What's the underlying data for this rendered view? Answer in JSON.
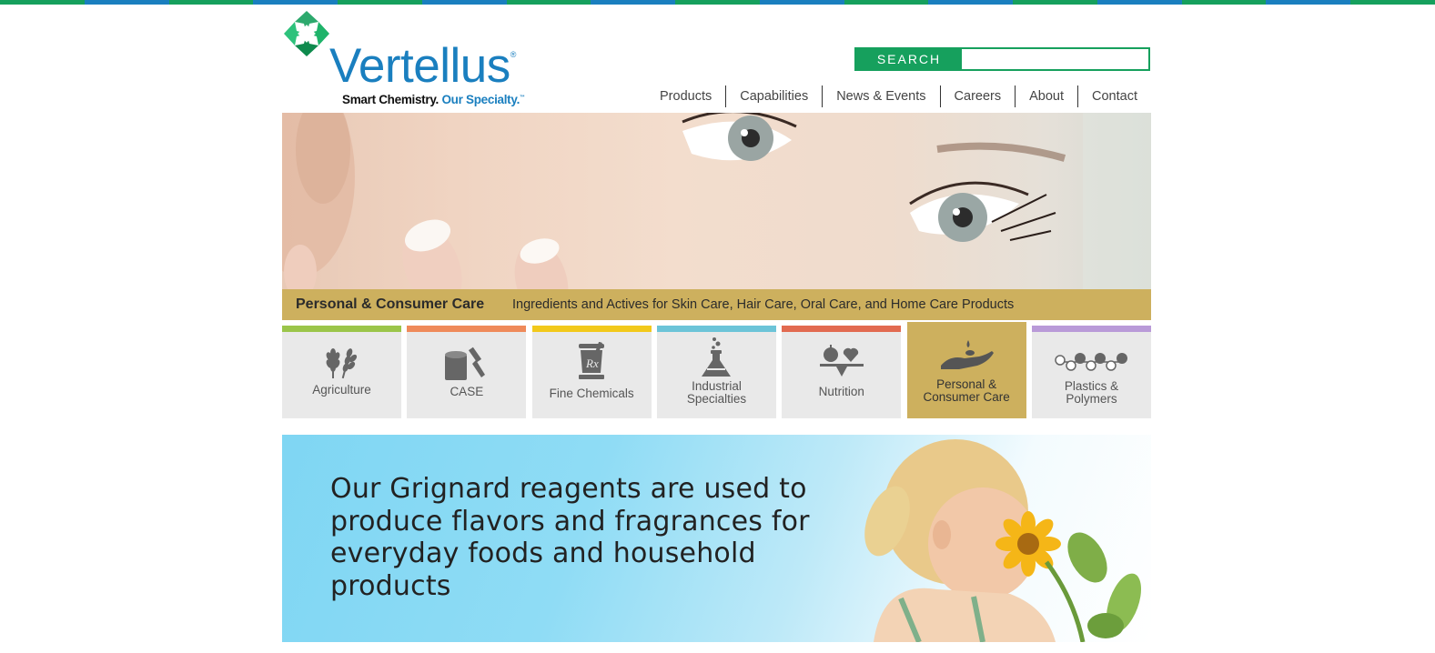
{
  "brand": {
    "name": "Vertellus",
    "registered": "®",
    "tagline_dark": "Smart Chemistry.",
    "tagline_blue": "Our Specialty.",
    "tagline_mark": "™",
    "colors": {
      "blue": "#1a7fbf",
      "green": "#16a05d",
      "gold": "#cdb05e"
    }
  },
  "top_strip_colors": [
    "#16a05d",
    "#1a7fbf",
    "#16a05d",
    "#1a7fbf",
    "#16a05d",
    "#1a7fbf",
    "#16a05d",
    "#1a7fbf",
    "#16a05d",
    "#1a7fbf",
    "#16a05d",
    "#1a7fbf",
    "#16a05d",
    "#1a7fbf",
    "#16a05d",
    "#1a7fbf",
    "#16a05d"
  ],
  "search": {
    "button_label": "SEARCH",
    "value": "",
    "placeholder": ""
  },
  "nav": {
    "items": [
      {
        "label": "Products"
      },
      {
        "label": "Capabilities"
      },
      {
        "label": "News & Events"
      },
      {
        "label": "Careers"
      },
      {
        "label": "About"
      },
      {
        "label": "Contact"
      }
    ]
  },
  "hero": {
    "title": "Personal & Consumer Care",
    "description": "Ingredients and Actives for Skin Care, Hair Care, Oral Care, and Home Care Products"
  },
  "categories": [
    {
      "line1": "Agriculture",
      "line2": "",
      "icon": "wheat-icon",
      "color": "#9bc54a",
      "active": false
    },
    {
      "line1": "CASE",
      "line2": "",
      "icon": "paint-can-brush-icon",
      "color": "#ef8a5a",
      "active": false
    },
    {
      "line1": "Fine Chemicals",
      "line2": "",
      "icon": "mortar-pestle-rx-icon",
      "color": "#f2c91b",
      "active": false
    },
    {
      "line1": "Industrial",
      "line2": "Specialties",
      "icon": "flask-icon",
      "color": "#6cc4d8",
      "active": false
    },
    {
      "line1": "Nutrition",
      "line2": "",
      "icon": "apple-heart-scale-icon",
      "color": "#e26a50",
      "active": false
    },
    {
      "line1": "Personal &",
      "line2": "Consumer Care",
      "icon": "hand-drop-icon",
      "color": "#cdb05e",
      "active": true
    },
    {
      "line1": "Plastics &",
      "line2": "Polymers",
      "icon": "polymer-chain-icon",
      "color": "#b99ad8",
      "active": false
    }
  ],
  "banner": {
    "text": "Our Grignard reagents are used to produce flavors and fragrances for everyday foods and household products"
  }
}
